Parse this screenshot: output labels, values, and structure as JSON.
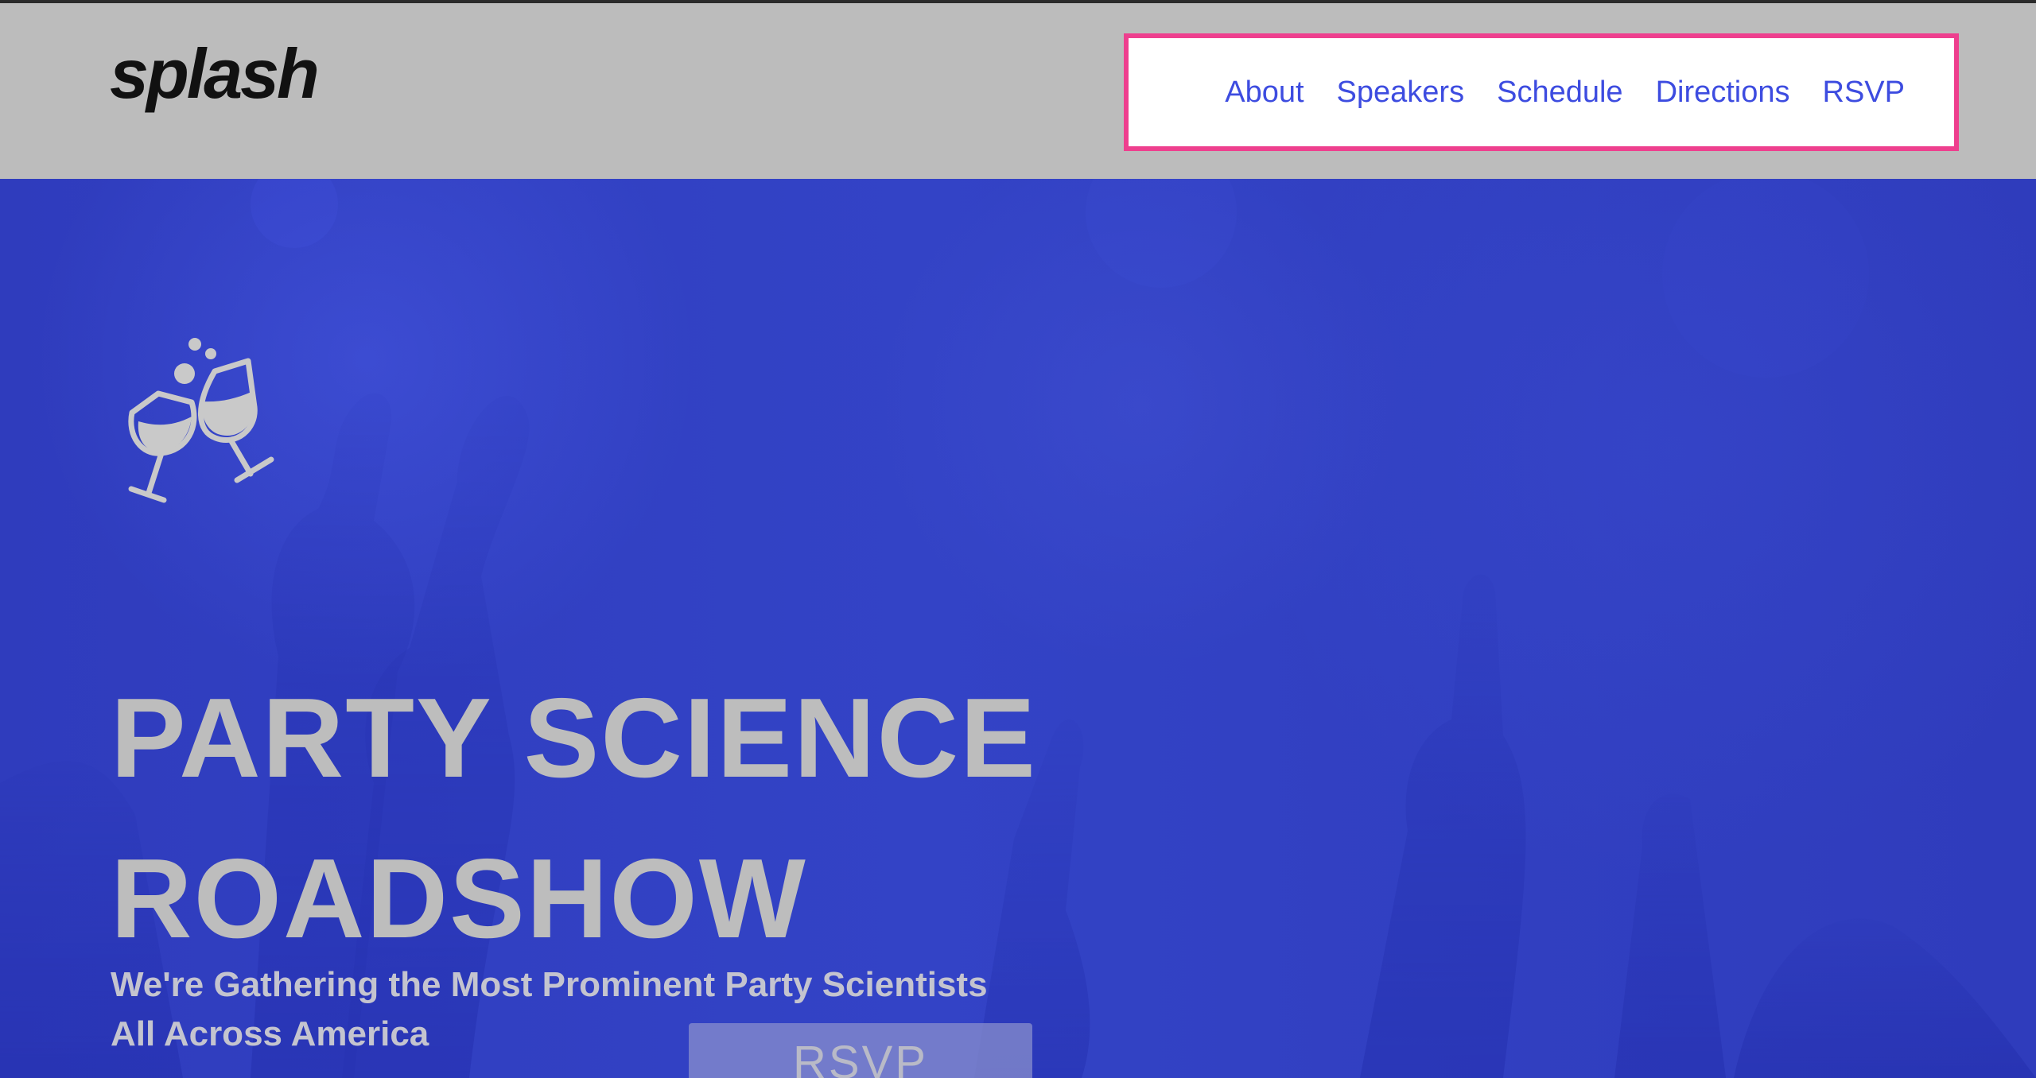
{
  "header": {
    "logo": "splash",
    "nav": [
      "About",
      "Speakers",
      "Schedule",
      "Directions",
      "RSVP"
    ]
  },
  "hero": {
    "title": "PARTY SCIENCE ROADSHOW",
    "subtitle": "We're Gathering the Most Prominent Party Scientists\nAll Across America",
    "rsvp_button": "RSVP",
    "icon": "champagne-glasses-icon"
  },
  "colors": {
    "header_bg": "#bcbcbc",
    "nav_text": "#3d4ce0",
    "highlight": "#ee3f8e",
    "hero_bg": "#2f3dbe",
    "hero_text": "#bdbdbd"
  }
}
